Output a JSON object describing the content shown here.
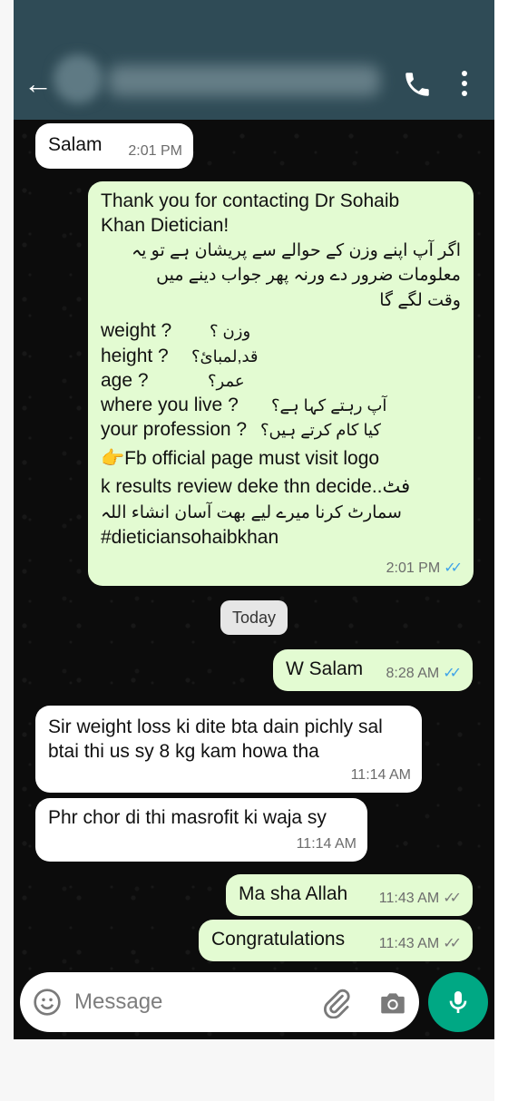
{
  "header": {
    "back_icon": "arrow-left-icon",
    "call_icon": "phone-icon",
    "menu_icon": "more-vertical-icon"
  },
  "messages": [
    {
      "text": "Salam",
      "time": "2:01 PM"
    },
    {
      "lines_en_top": [
        "Thank you for contacting Dr Sohaib",
        "Khan Dietician!"
      ],
      "urdu_par": [
        "اگر آپ اپنے وزن کے حوالے سے پریشان ہے تو یہ",
        "معلومات ضرور دے ورنہ پھر جواب دینے میں",
        "وقت لگے گا"
      ],
      "qa": [
        {
          "en": "weight ?",
          "ur": "وزن ؟"
        },
        {
          "en": "height ?",
          "ur": "قد,لمبائ؟"
        },
        {
          "en": "age  ?",
          "ur": "عمر؟"
        },
        {
          "en": "where you live ?",
          "ur": "آپ رہتے کہا ہے؟"
        },
        {
          "en": "your profession ?",
          "ur": "کیا کام کرتے ہیں؟"
        }
      ],
      "line_fb": "👉Fb official page must visit logo",
      "line_results": "k results review deke thn decide..فٹ",
      "line_urdu_end": "سمارٹ کرنا میرے لیے بھت آسان انشاء اللہ",
      "hashtag": "#dieticiansohaibkhan",
      "time": "2:01 PM"
    },
    {
      "text": "W Salam",
      "time": "8:28 AM"
    },
    {
      "text": "Sir weight loss ki dite bta dain pichly sal btai thi us sy 8 kg kam howa tha",
      "time": "11:14 AM"
    },
    {
      "text": "Phr chor di thi masrofit ki waja sy",
      "time": "11:14 AM"
    },
    {
      "text": "Ma sha Allah",
      "time": "11:43 AM"
    },
    {
      "text": "Congratulations",
      "time": "11:43 AM"
    }
  ],
  "date_divider": "Today",
  "composer": {
    "placeholder": "Message",
    "emoji_icon": "emoji-icon",
    "attach_icon": "paperclip-icon",
    "camera_icon": "camera-icon",
    "mic_icon": "mic-icon"
  },
  "colors": {
    "header": "#2f4b56",
    "incoming": "#ffffff",
    "outgoing": "#e3fbd2",
    "read_ticks": "#3fa3e8",
    "mic_button": "#00a884"
  }
}
